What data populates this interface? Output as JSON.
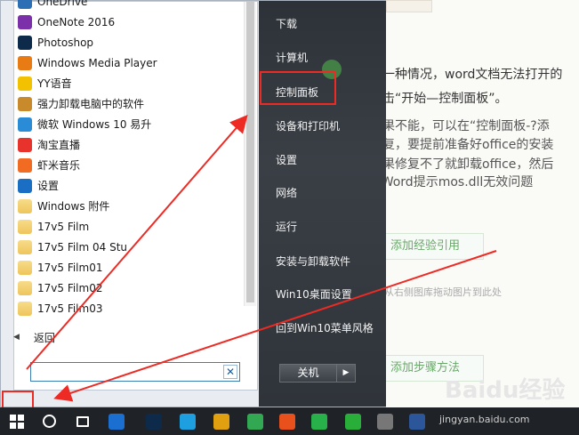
{
  "start_menu": {
    "programs": [
      {
        "label": "OneDrive",
        "icon": "onedrive-icon",
        "color": "#2d6fb5"
      },
      {
        "label": "OneNote 2016",
        "icon": "onenote-icon",
        "color": "#7b2fa8"
      },
      {
        "label": "Photoshop",
        "icon": "photoshop-icon",
        "color": "#0e2a4a"
      },
      {
        "label": "Windows Media Player",
        "icon": "media-player-icon",
        "color": "#e87b14"
      },
      {
        "label": "YY语音",
        "icon": "yy-icon",
        "color": "#f2c200"
      },
      {
        "label": "强力卸载电脑中的软件",
        "icon": "uninstall-icon",
        "color": "#c98a2c"
      },
      {
        "label": "微软 Windows 10 易升",
        "icon": "upgrade-icon",
        "color": "#2a8cd6"
      },
      {
        "label": "淘宝直播",
        "icon": "taobao-live-icon",
        "color": "#e8332c"
      },
      {
        "label": "虾米音乐",
        "icon": "xiami-icon",
        "color": "#f26b22"
      },
      {
        "label": "设置",
        "icon": "settings-icon",
        "color": "#1a6fc4"
      },
      {
        "label": "Windows 附件",
        "icon": "folder-icon",
        "color": "#eec55a"
      },
      {
        "label": "17v5 Film",
        "icon": "folder-icon",
        "color": "#eec55a"
      },
      {
        "label": "17v5 Film 04 Stu",
        "icon": "folder-icon",
        "color": "#eec55a"
      },
      {
        "label": "17v5 Film01",
        "icon": "folder-icon",
        "color": "#eec55a"
      },
      {
        "label": "17v5 Film02",
        "icon": "folder-icon",
        "color": "#eec55a"
      },
      {
        "label": "17v5 Film03",
        "icon": "folder-icon",
        "color": "#eec55a"
      }
    ],
    "back_label": "返回",
    "search_placeholder": "",
    "right_items": [
      "下载",
      "计算机",
      "控制面板",
      "设备和打印机",
      "设置",
      "网络",
      "运行",
      "安装与卸载软件",
      "Win10桌面设置",
      "回到Win10菜单风格"
    ],
    "shutdown_label": "关机"
  },
  "background": {
    "lines": [
      "第一种情况，word文档无法打开的",
      "点击“开始—控制面板”。",
      "如果不能，可以在“控制面板-?添",
      "修复，要提前准备好office的安装",
      "如果修复不了就卸载office，然后",
      "• Word提示mos.dll无效问题"
    ],
    "add_ref_button": "添加经验引用",
    "drag_hint": "从右侧图库拖动图片到此处",
    "add_step_button": "添加步骤方法",
    "watermark": "Baidu经验"
  },
  "taskbar": {
    "url": "jingyan.baidu.com",
    "icons": [
      {
        "name": "cortana-icon",
        "color": "#1f2226"
      },
      {
        "name": "task-view-icon",
        "color": "#1f2226"
      },
      {
        "name": "media-icon",
        "color": "#1b6fd1"
      },
      {
        "name": "photoshop-icon",
        "color": "#0e2a4a"
      },
      {
        "name": "app-blue-icon",
        "color": "#1ea0e0"
      },
      {
        "name": "chrome-icon",
        "color": "#e0a010"
      },
      {
        "name": "green-app-icon",
        "color": "#33a852"
      },
      {
        "name": "firefox-icon",
        "color": "#e8501c"
      },
      {
        "name": "iqiyi-icon",
        "color": "#28b04a"
      },
      {
        "name": "wechat-icon",
        "color": "#2aae3a"
      },
      {
        "name": "user-icon",
        "color": "#777"
      },
      {
        "name": "word-icon",
        "color": "#2b579a"
      }
    ]
  },
  "colors": {
    "annotation": "#ee2a24",
    "menu_dark": "#2d3238",
    "taskbar": "#1f2226"
  }
}
